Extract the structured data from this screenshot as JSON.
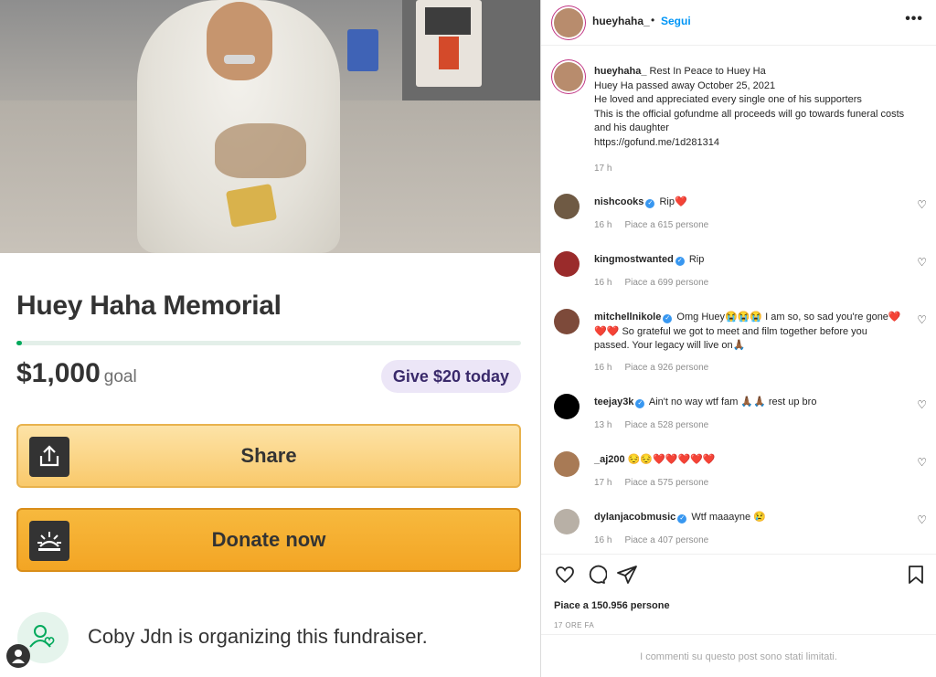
{
  "fundraiser": {
    "title": "Huey Haha Memorial",
    "progress_fraction": 0.01,
    "amount": "$1,000",
    "goal_label": "goal",
    "give_pill": "Give $20 today",
    "share_label": "Share",
    "donate_label": "Donate now",
    "organizer_text": "Coby Jdn is organizing this fundraiser."
  },
  "header": {
    "username": "hueyhaha_",
    "dot": "•",
    "follow": "Segui",
    "more": "•••"
  },
  "caption": {
    "username": "hueyhaha_",
    "line1": "Rest In Peace to Huey Ha",
    "line2": "Huey Ha passed away October 25, 2021",
    "line3": "He loved and appreciated every single one of his supporters",
    "line4": "This is the official gofundme all proceeds will go towards funeral costs and his daughter",
    "line5": "https://gofund.me/1d281314",
    "time": "17 h"
  },
  "comments": [
    {
      "user": "nishcooks",
      "text": "Rip❤️",
      "time": "16 h",
      "likes": "Piace a 615 persone",
      "color": "#6f5a44"
    },
    {
      "user": "kingmostwanted",
      "text": "Rip",
      "time": "16 h",
      "likes": "Piace a 699 persone",
      "color": "#9a2b2b"
    },
    {
      "user": "mitchellnikole",
      "text": "Omg Huey😭😭😭 I am so, so sad you're gone❤️❤️❤️ So grateful we got to meet and film together before you passed. Your legacy will live on🙏🏾",
      "time": "16 h",
      "likes": "Piace a 926 persone",
      "color": "#7d4a3a"
    },
    {
      "user": "teejay3k",
      "text": "Ain't no way wtf fam 🙏🏾🙏🏾 rest up bro",
      "time": "13 h",
      "likes": "Piace a 528 persone",
      "color": "#000000"
    },
    {
      "user": "_aj200",
      "text": "😔😔❤️❤️❤️❤️❤️",
      "time": "17 h",
      "likes": "Piace a 575 persone",
      "color": "#a87a55"
    },
    {
      "user": "dylanjacobmusic",
      "text": "Wtf maaayne 😢",
      "time": "16 h",
      "likes": "Piace a 407 persone",
      "color": "#b8b0a6"
    }
  ],
  "footer": {
    "likes": "Piace a 150.956 persone",
    "date": "17 ORE FA",
    "limited": "I commenti su questo post sono stati limitati."
  },
  "icons": {
    "heart": "heart-icon",
    "comment": "comment-icon",
    "share": "paper-plane-icon",
    "save": "bookmark-icon"
  }
}
